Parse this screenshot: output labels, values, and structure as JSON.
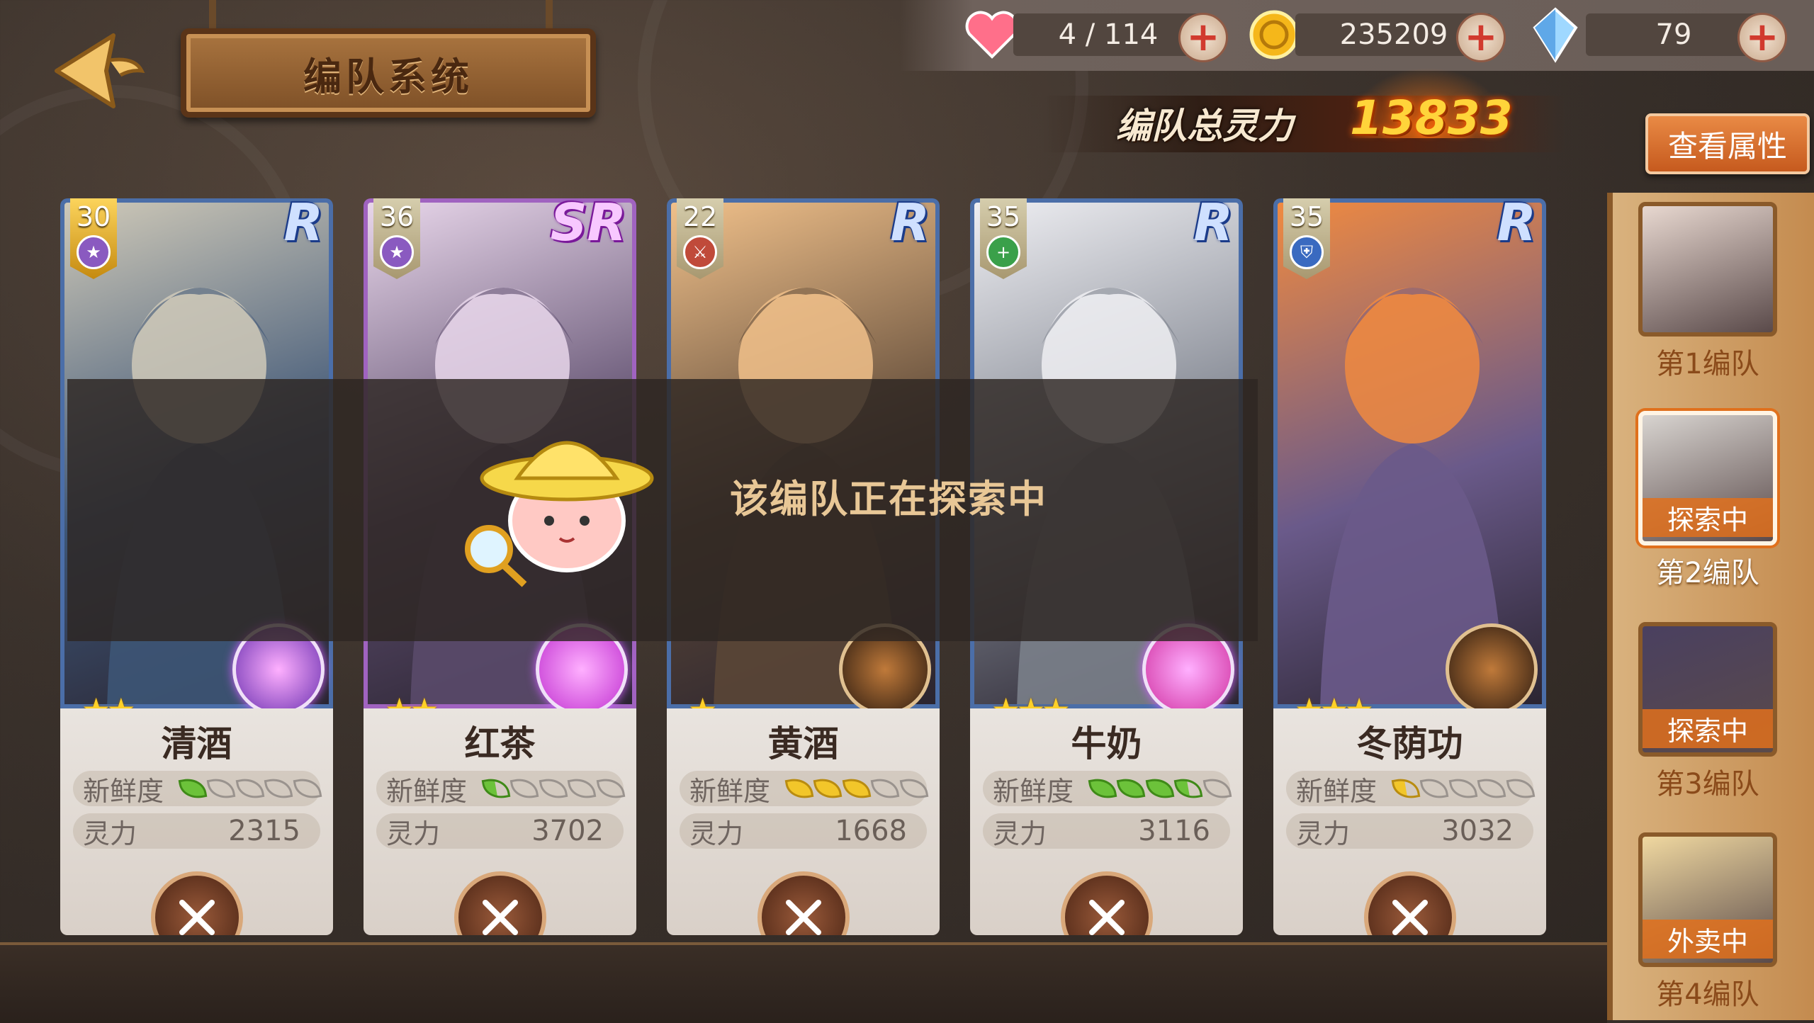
{
  "header": {
    "title": "编队系统"
  },
  "resources": [
    {
      "icon": "heart-icon",
      "value": "4 / 114"
    },
    {
      "icon": "gold-coin-icon",
      "value": "235209"
    },
    {
      "icon": "crystal-icon",
      "value": "79"
    }
  ],
  "power": {
    "label": "编队总灵力",
    "value": "13833"
  },
  "view_attributes_label": "查看属性",
  "overlay_text": "该编队正在探索中",
  "cards": [
    {
      "level": "30",
      "rarity": "R",
      "stars": 2,
      "name": "清酒",
      "freshness_label": "新鲜度",
      "freshness": [
        "g",
        "e",
        "e",
        "e",
        "e"
      ],
      "power_label": "灵力",
      "power": "2315",
      "class_icon": "star-class-icon"
    },
    {
      "level": "36",
      "rarity": "SR",
      "stars": 2,
      "name": "红茶",
      "freshness_label": "新鲜度",
      "freshness": [
        "hg",
        "e",
        "e",
        "e",
        "e"
      ],
      "power_label": "灵力",
      "power": "3702",
      "class_icon": "star-class-icon"
    },
    {
      "level": "22",
      "rarity": "R",
      "stars": 1,
      "name": "黄酒",
      "freshness_label": "新鲜度",
      "freshness": [
        "y",
        "y",
        "y",
        "e",
        "e"
      ],
      "power_label": "灵力",
      "power": "1668",
      "class_icon": "sword-class-icon"
    },
    {
      "level": "35",
      "rarity": "R",
      "stars": 3,
      "name": "牛奶",
      "freshness_label": "新鲜度",
      "freshness": [
        "g",
        "g",
        "g",
        "hg",
        "e"
      ],
      "power_label": "灵力",
      "power": "3116",
      "class_icon": "heal-class-icon"
    },
    {
      "level": "35",
      "rarity": "R",
      "stars": 3,
      "name": "冬荫功",
      "freshness_label": "新鲜度",
      "freshness": [
        "h",
        "e",
        "e",
        "e",
        "e"
      ],
      "power_label": "灵力",
      "power": "3032",
      "class_icon": "shield-class-icon"
    }
  ],
  "teams": [
    {
      "label": "第1编队",
      "status": ""
    },
    {
      "label": "第2编队",
      "status": "探索中"
    },
    {
      "label": "第3编队",
      "status": "探索中"
    },
    {
      "label": "第4编队",
      "status": "外卖中"
    }
  ]
}
